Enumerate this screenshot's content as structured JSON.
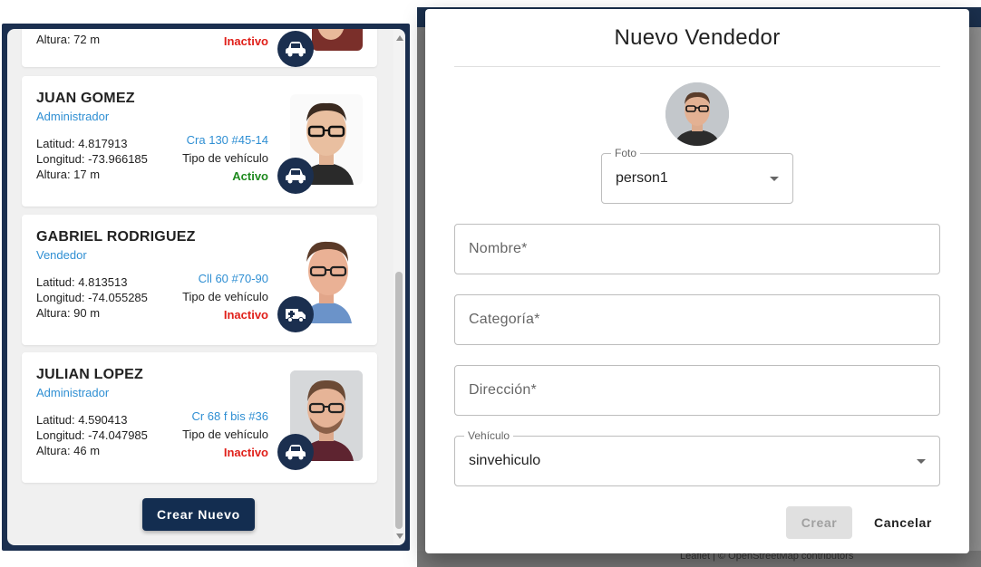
{
  "sidebar": {
    "partial_card": {
      "altura": "Altura: 72 m",
      "status": "Inactivo",
      "vehicle_icon": "car-icon"
    },
    "cards": [
      {
        "name": "JUAN GOMEZ",
        "role": "Administrador",
        "latitud": "Latitud: 4.817913",
        "longitud": "Longitud: -73.966185",
        "altura": "Altura: 17 m",
        "address": "Cra 130 #45-14",
        "vehicle_label": "Tipo de vehículo",
        "status": "Activo",
        "vehicle_icon": "car-icon"
      },
      {
        "name": "GABRIEL RODRIGUEZ",
        "role": "Vendedor",
        "latitud": "Latitud: 4.813513",
        "longitud": "Longitud: -74.055285",
        "altura": "Altura: 90 m",
        "address": "Cll 60 #70-90",
        "vehicle_label": "Tipo de vehículo",
        "status": "Inactivo",
        "vehicle_icon": "ambulance-icon"
      },
      {
        "name": "JULIAN LOPEZ",
        "role": "Administrador",
        "latitud": "Latitud: 4.590413",
        "longitud": "Longitud: -74.047985",
        "altura": "Altura: 46 m",
        "address": "Cr 68 f bis #36",
        "vehicle_label": "Tipo de vehículo",
        "status": "Inactivo",
        "vehicle_icon": "car-icon"
      }
    ],
    "create_button": "Crear Nuevo"
  },
  "map": {
    "attribution": "Leaflet | © OpenStreetMap contributors"
  },
  "dialog": {
    "title": "Nuevo Vendedor",
    "foto": {
      "label": "Foto",
      "value": "person1"
    },
    "nombre_placeholder": "Nombre*",
    "categoria_placeholder": "Categoría*",
    "direccion_placeholder": "Dirección*",
    "vehiculo": {
      "label": "Vehículo",
      "value": "sinvehiculo"
    },
    "crear_button": "Crear",
    "cancelar_button": "Cancelar"
  },
  "colors": {
    "navy": "#1b2f4f",
    "link_blue": "#2f8fd3",
    "inactive_red": "#e0201a",
    "active_green": "#1f8a1f"
  }
}
